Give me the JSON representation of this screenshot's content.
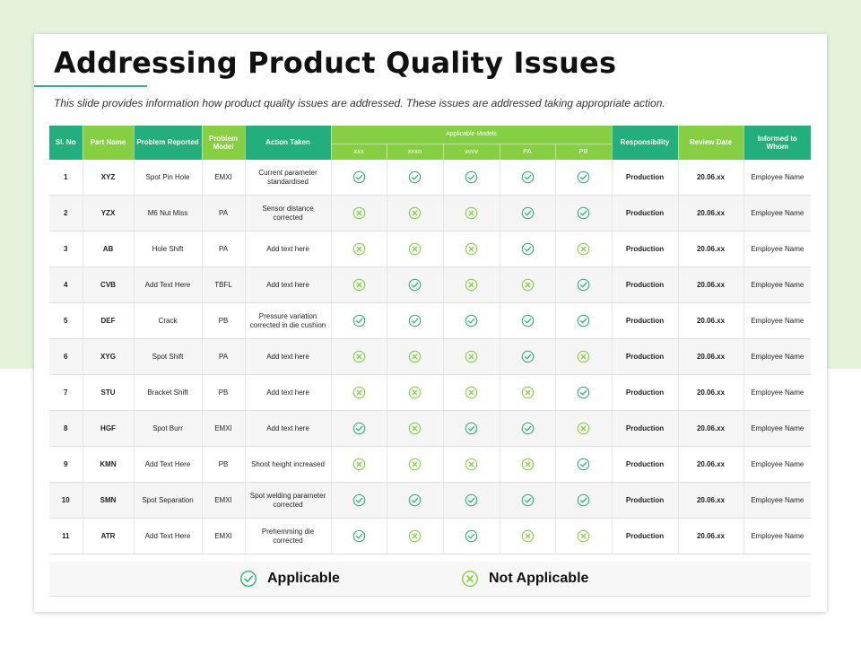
{
  "title": "Addressing Product Quality Issues",
  "subtitle": "This slide provides information how product quality issues are addressed. These issues are addressed taking appropriate action.",
  "colors": {
    "header_green": "#22ae7d",
    "header_light_green": "#86cf43",
    "applicable_icon": "#2eb37a",
    "not_applicable_icon": "#86cf43"
  },
  "icons": {
    "applicable": "check-circle-icon",
    "not_applicable": "x-circle-icon"
  },
  "table": {
    "headers": {
      "sl_no": "Sl. No",
      "part_name": "Part Name",
      "problem_reported": "Problem Reported",
      "problem_model": "Problem Model",
      "action_taken": "Action Taken",
      "applicable_models": "Applicable Models",
      "models": [
        "xxx",
        "xxxn",
        "vvvv",
        "PA",
        "PB"
      ],
      "responsibility": "Responsibility",
      "review_date": "Review Date",
      "informed_to": "Informed to Whom"
    },
    "rows": [
      {
        "sl": "1",
        "part": "XYZ",
        "problem": "Spot Pin Hole",
        "model": "EMXI",
        "action": "Current parameter standardised",
        "applicable": [
          true,
          true,
          true,
          true,
          true
        ],
        "responsibility": "Production",
        "review_date": "20.06.xx",
        "informed": "Employee Name"
      },
      {
        "sl": "2",
        "part": "YZX",
        "problem": "M6 Nut Miss",
        "model": "PA",
        "action": "Sensor distance corrected",
        "applicable": [
          false,
          false,
          false,
          true,
          true
        ],
        "responsibility": "Production",
        "review_date": "20.06.xx",
        "informed": "Employee Name"
      },
      {
        "sl": "3",
        "part": "AB",
        "problem": "Hole Shift",
        "model": "PA",
        "action": "Add text here",
        "applicable": [
          false,
          false,
          false,
          true,
          false
        ],
        "responsibility": "Production",
        "review_date": "20.06.xx",
        "informed": "Employee Name"
      },
      {
        "sl": "4",
        "part": "CVB",
        "problem": "Add Text Here",
        "model": "TBFL",
        "action": "Add text here",
        "applicable": [
          false,
          true,
          false,
          false,
          true
        ],
        "responsibility": "Production",
        "review_date": "20.06.xx",
        "informed": "Employee Name"
      },
      {
        "sl": "5",
        "part": "DEF",
        "problem": "Crack",
        "model": "PB",
        "action": "Pressure variation corrected in die cushion",
        "applicable": [
          true,
          true,
          true,
          true,
          true
        ],
        "responsibility": "Production",
        "review_date": "20.06.xx",
        "informed": "Employee Name"
      },
      {
        "sl": "6",
        "part": "XYG",
        "problem": "Spot Shift",
        "model": "PA",
        "action": "Add text here",
        "applicable": [
          false,
          false,
          false,
          true,
          false
        ],
        "responsibility": "Production",
        "review_date": "20.06.xx",
        "informed": "Employee Name"
      },
      {
        "sl": "7",
        "part": "STU",
        "problem": "Bracket Shift",
        "model": "PB",
        "action": "Add text here",
        "applicable": [
          false,
          false,
          false,
          false,
          true
        ],
        "responsibility": "Production",
        "review_date": "20.06.xx",
        "informed": "Employee Name"
      },
      {
        "sl": "8",
        "part": "HGF",
        "problem": "Spot Burr",
        "model": "EMXI",
        "action": "Add text here",
        "applicable": [
          true,
          false,
          true,
          true,
          false
        ],
        "responsibility": "Production",
        "review_date": "20.06.xx",
        "informed": "Employee Name"
      },
      {
        "sl": "9",
        "part": "KMN",
        "problem": "Add Text Here",
        "model": "PB",
        "action": "Shoot height increased",
        "applicable": [
          false,
          false,
          false,
          false,
          true
        ],
        "responsibility": "Production",
        "review_date": "20.06.xx",
        "informed": "Employee Name"
      },
      {
        "sl": "10",
        "part": "SMN",
        "problem": "Spot Separation",
        "model": "EMXI",
        "action": "Spot welding parameter corrected",
        "applicable": [
          true,
          true,
          true,
          true,
          true
        ],
        "responsibility": "Production",
        "review_date": "20.06.xx",
        "informed": "Employee Name"
      },
      {
        "sl": "11",
        "part": "ATR",
        "problem": "Add Text Here",
        "model": "EMXI",
        "action": "Prehemming die corrected",
        "applicable": [
          true,
          false,
          true,
          false,
          false
        ],
        "responsibility": "Production",
        "review_date": "20.06.xx",
        "informed": "Employee Name"
      }
    ]
  },
  "legend": {
    "applicable": "Applicable",
    "not_applicable": "Not Applicable"
  }
}
